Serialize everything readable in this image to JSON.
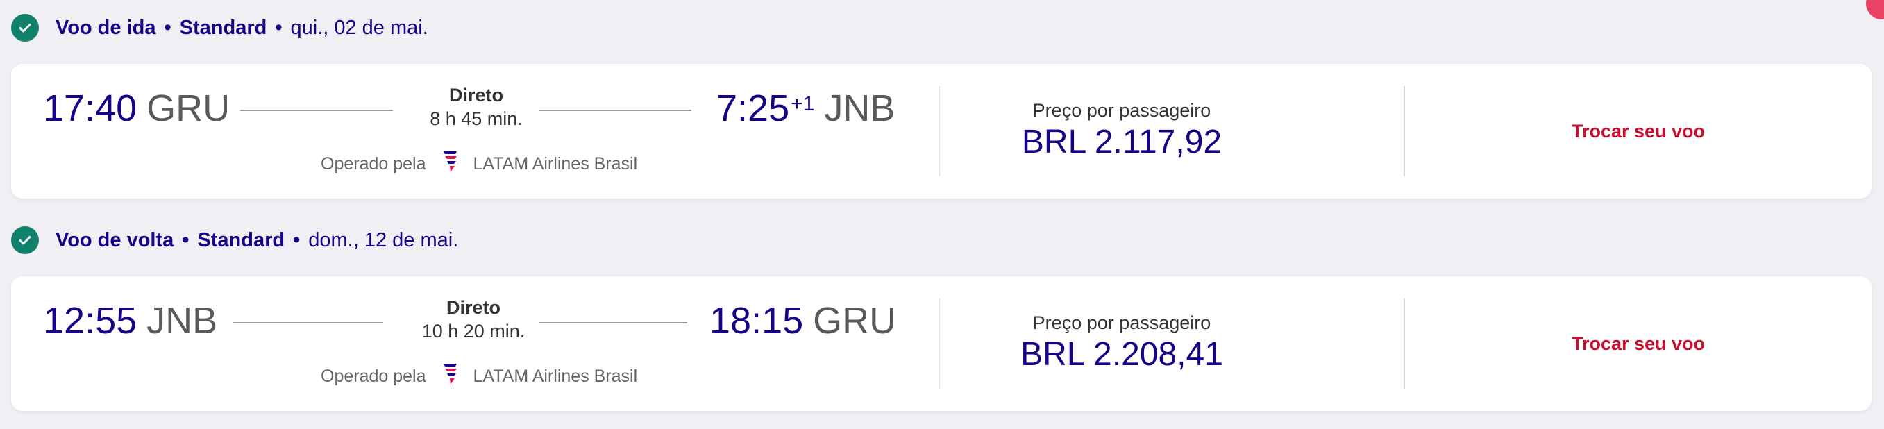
{
  "outbound": {
    "direction": "Voo de ida",
    "fare": "Standard",
    "date": "qui., 02 de mai.",
    "depart_time": "17:40",
    "depart_code": "GRU",
    "route_type": "Direto",
    "duration": "8 h 45 min.",
    "arrive_time": "7:25",
    "arrive_day_offset": "+1",
    "arrive_code": "JNB",
    "operated_label": "Operado pela",
    "airline": "LATAM Airlines Brasil",
    "price_label": "Preço por passageiro",
    "price": "BRL 2.117,92",
    "change_label": "Trocar seu voo"
  },
  "return": {
    "direction": "Voo de volta",
    "fare": "Standard",
    "date": "dom., 12 de mai.",
    "depart_time": "12:55",
    "depart_code": "JNB",
    "route_type": "Direto",
    "duration": "10 h 20 min.",
    "arrive_time": "18:15",
    "arrive_code": "GRU",
    "operated_label": "Operado pela",
    "airline": "LATAM Airlines Brasil",
    "price_label": "Preço por passageiro",
    "price": "BRL 2.208,41",
    "change_label": "Trocar seu voo"
  },
  "colors": {
    "primary": "#1b0088",
    "accent": "#c8102e",
    "check": "#10806b",
    "background": "#f0eff4"
  },
  "icons": {
    "check": "check-circle-icon",
    "airline": "latam-logo-icon"
  }
}
